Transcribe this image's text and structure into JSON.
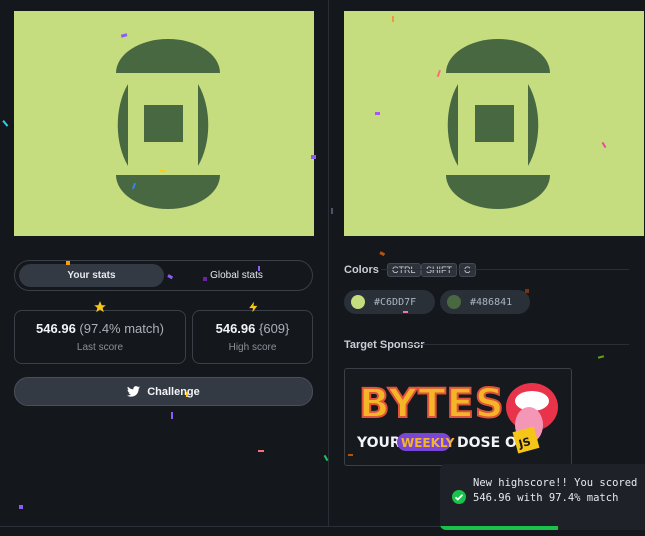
{
  "stats": {
    "tabs": [
      {
        "label": "Your stats",
        "active": true
      },
      {
        "label": "Global stats",
        "active": false
      }
    ],
    "last": {
      "icon": "star-icon",
      "score": "546.96",
      "match": "(97.4% match)",
      "label": "Last score"
    },
    "high": {
      "icon": "lightning-icon",
      "score": "546.96",
      "rank": "{609}",
      "label": "High score"
    },
    "challenge_label": "Challenge"
  },
  "colors_section": {
    "title": "Colors",
    "shortcut": [
      "CTRL",
      "SHIFT",
      "C"
    ],
    "chips": [
      {
        "hex": "#C6DD7F",
        "color": "#C6DD7F"
      },
      {
        "hex": "#486841",
        "color": "#486841"
      }
    ]
  },
  "sponsor": {
    "title": "Target Sponsor",
    "logo": {
      "word": "BYTES",
      "tagline_1": "YOUR",
      "tagline_2": "WEEKLY",
      "tagline_3": "DOSE OF",
      "badge": "JS"
    }
  },
  "target": {
    "background": "#C6DD7F",
    "foreground": "#486841"
  },
  "toast": {
    "message": "New highscore!! You scored 546.96 with 97.4% match",
    "progress": 0.56
  }
}
